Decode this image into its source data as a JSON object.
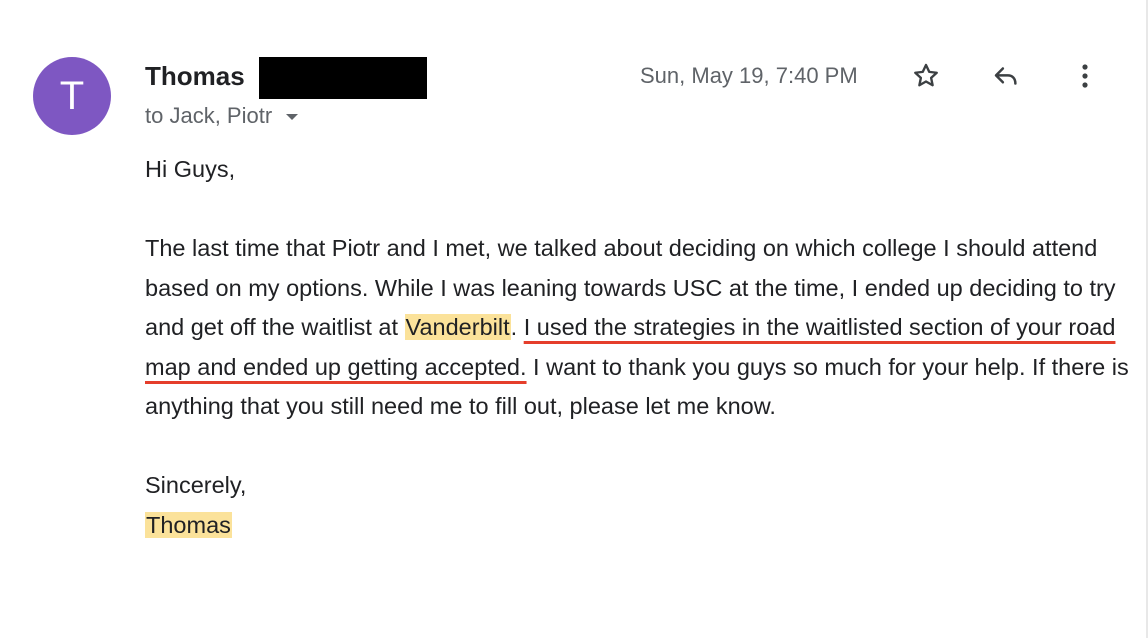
{
  "sender": {
    "avatar_letter": "T",
    "avatar_color": "#7e57c2",
    "name": "Thomas",
    "recipients": "to Jack, Piotr",
    "date": "Sun, May 19, 7:40 PM"
  },
  "icons": {
    "star": "star-icon",
    "reply": "reply-icon",
    "more": "more-vert-icon",
    "recipients_caret": "chevron-down-icon"
  },
  "message": {
    "greeting": "Hi Guys,",
    "para_part1": "The last time that Piotr and I met, we talked about deciding on which college I should attend based on my options. While I was leaning towards USC at the time, I ended up deciding to try and get off the waitlist at ",
    "para_highlight": "Vanderbilt",
    "para_part2": ". ",
    "para_underlined": "I used the strategies in the waitlisted section of your road map and ended up getting accepted.",
    "para_part3": " I want to thank you guys so much for your help. If there is anything that you still need me to fill out, please let me know.",
    "closing": "Sincerely,",
    "signature": "Thomas"
  },
  "colors": {
    "highlight": "#fbe29a",
    "underline": "#e53e2b",
    "secondary_text": "#5f6368"
  }
}
